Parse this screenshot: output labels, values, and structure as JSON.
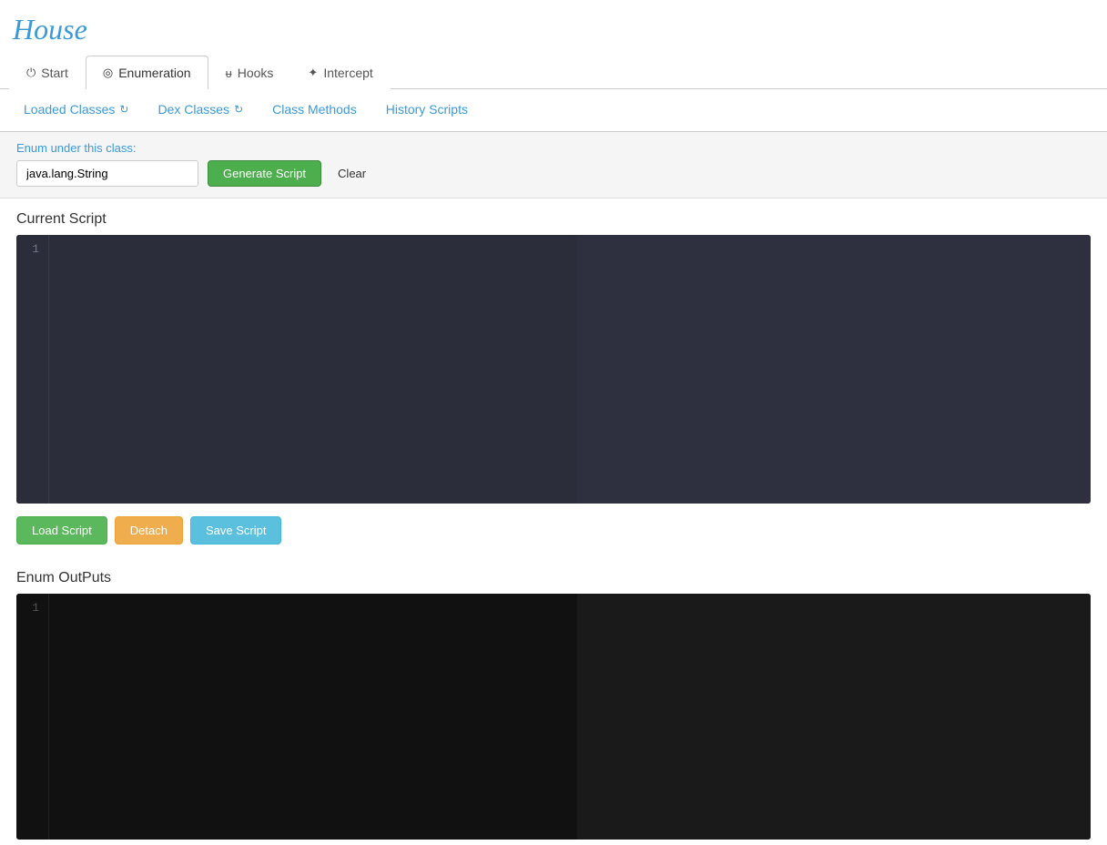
{
  "app": {
    "title": "House"
  },
  "main_nav": {
    "tabs": [
      {
        "id": "start",
        "label": "Start",
        "icon": "⏻",
        "active": false
      },
      {
        "id": "enumeration",
        "label": "Enumeration",
        "icon": "◎",
        "active": true
      },
      {
        "id": "hooks",
        "label": "Hooks",
        "icon": "ᵾ",
        "active": false
      },
      {
        "id": "intercept",
        "label": "Intercept",
        "icon": "✦",
        "active": false
      }
    ]
  },
  "sub_tabs": {
    "tabs": [
      {
        "id": "loaded-classes",
        "label": "Loaded Classes",
        "has_refresh": true
      },
      {
        "id": "dex-classes",
        "label": "Dex Classes",
        "has_refresh": true
      },
      {
        "id": "class-methods",
        "label": "Class Methods",
        "has_refresh": false
      },
      {
        "id": "history-scripts",
        "label": "History Scripts",
        "has_refresh": false
      }
    ]
  },
  "enum_bar": {
    "label": "Enum under this class:",
    "input_value": "java.lang.String",
    "input_placeholder": "java.lang.String",
    "generate_btn": "Generate Script",
    "clear_btn": "Clear"
  },
  "current_script": {
    "section_title": "Current Script",
    "line_number": "1",
    "content": ""
  },
  "script_buttons": {
    "load_label": "Load Script",
    "detach_label": "Detach",
    "save_label": "Save Script"
  },
  "enum_outputs": {
    "section_title": "Enum OutPuts",
    "line_number": "1",
    "content": ""
  }
}
